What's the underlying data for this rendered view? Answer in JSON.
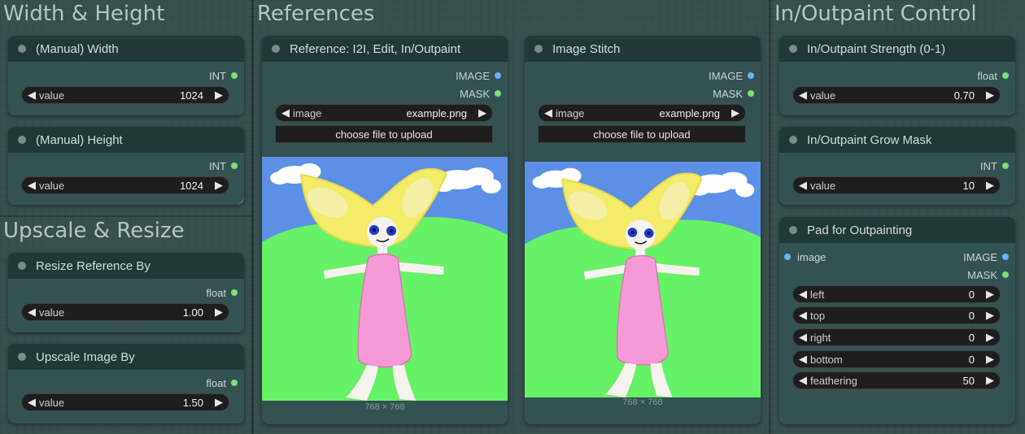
{
  "groups": {
    "width_height": {
      "title": "Width & Height"
    },
    "upscale_resize": {
      "title": "Upscale & Resize"
    },
    "references": {
      "title": "References"
    },
    "inoutpaint_control": {
      "title": "In/Outpaint Control"
    }
  },
  "nodes": {
    "manual_width": {
      "title": "(Manual) Width",
      "output": "INT",
      "widget_label": "value",
      "widget_value": "1024"
    },
    "manual_height": {
      "title": "(Manual) Height",
      "output": "INT",
      "widget_label": "value",
      "widget_value": "1024"
    },
    "resize_reference": {
      "title": "Resize Reference By",
      "output": "float",
      "widget_label": "value",
      "widget_value": "1.00"
    },
    "upscale_image": {
      "title": "Upscale Image By",
      "output": "float",
      "widget_label": "value",
      "widget_value": "1.50"
    },
    "reference": {
      "title": "Reference: I2I, Edit, In/Outpaint",
      "outputs": [
        "IMAGE",
        "MASK"
      ],
      "image_label": "image",
      "image_value": "example.png",
      "upload_label": "choose file to upload",
      "dims": "768 × 768"
    },
    "image_stitch": {
      "title": "Image Stitch",
      "outputs": [
        "IMAGE",
        "MASK"
      ],
      "image_label": "image",
      "image_value": "example.png",
      "upload_label": "choose file to upload",
      "dims": "768 × 768"
    },
    "inoutpaint_strength": {
      "title": "In/Outpaint Strength (0-1)",
      "output": "float",
      "widget_label": "value",
      "widget_value": "0.70"
    },
    "inoutpaint_grow_mask": {
      "title": "In/Outpaint Grow Mask",
      "output": "INT",
      "widget_label": "value",
      "widget_value": "10"
    },
    "pad_outpainting": {
      "title": "Pad for Outpainting",
      "input": "image",
      "outputs": [
        "IMAGE",
        "MASK"
      ],
      "widgets": [
        {
          "label": "left",
          "value": "0"
        },
        {
          "label": "top",
          "value": "0"
        },
        {
          "label": "right",
          "value": "0"
        },
        {
          "label": "bottom",
          "value": "0"
        },
        {
          "label": "feathering",
          "value": "50"
        }
      ]
    }
  },
  "glyphs": {
    "left_arrow": "◀",
    "right_arrow": "▶"
  },
  "colors": {
    "canvas_bg": "#2c3a3c",
    "node_body": "#355252",
    "node_header": "#203838",
    "int_float_socket": "#7be07b",
    "image_socket": "#64b5f6",
    "sky": "#5b90e6",
    "grass": "#66f266",
    "hair": "#f2ec6a",
    "dress": "#f59ad6"
  }
}
